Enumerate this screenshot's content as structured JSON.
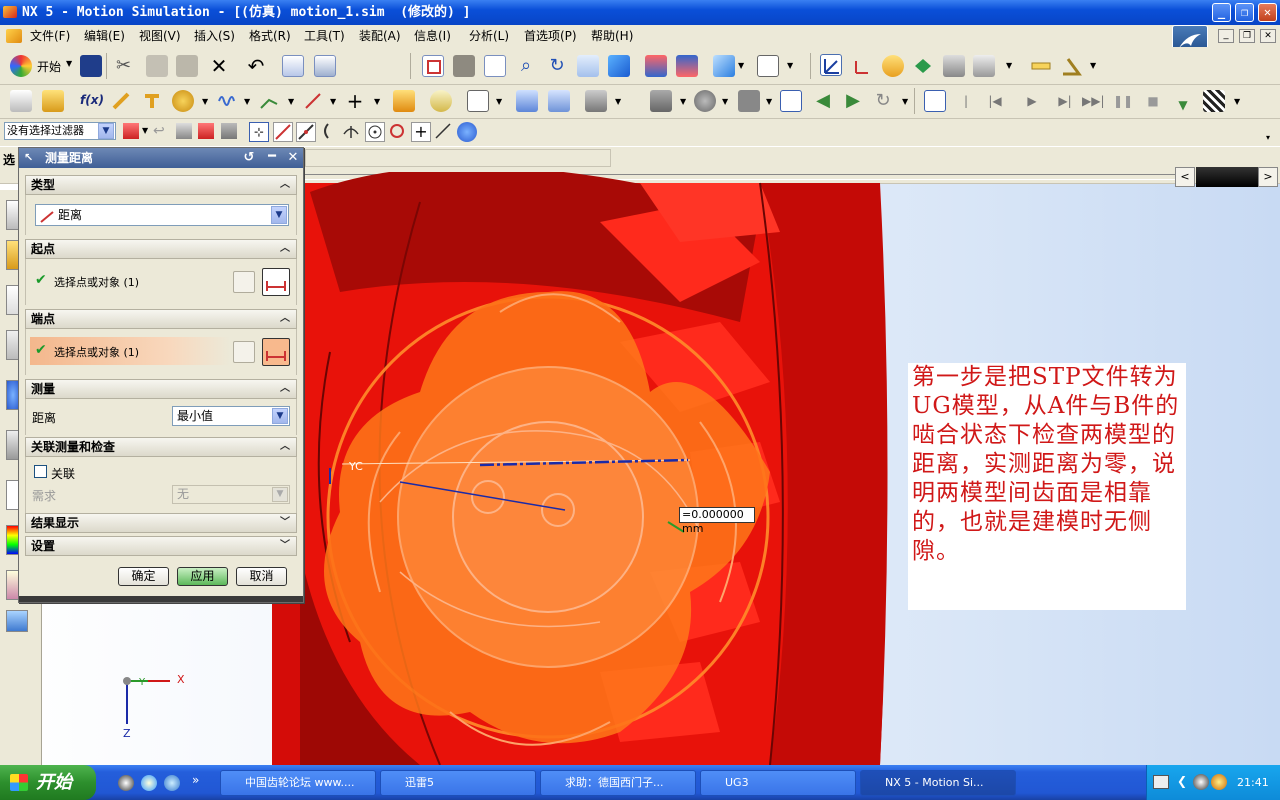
{
  "window": {
    "title": "NX 5 - Motion Simulation - [(仿真) motion_1.sim  (修改的) ]",
    "controls": [
      "minimize",
      "restore",
      "close"
    ]
  },
  "menubar": {
    "items": [
      "文件(F)",
      "编辑(E)",
      "视图(V)",
      "插入(S)",
      "格式(R)",
      "工具(T)",
      "装配(A)",
      "信息(I)",
      "分析(L)",
      "首选项(P)",
      "帮助(H)"
    ]
  },
  "toolbar": {
    "start_label": "开始",
    "filter_value": "没有选择过滤器",
    "fx_label": "f(x)"
  },
  "selection_bar": {
    "label": "选"
  },
  "dialog": {
    "title": "测量距离",
    "sections": {
      "type": {
        "header": "类型",
        "value": "距离"
      },
      "start": {
        "header": "起点",
        "select_label": "选择点或对象 (1)"
      },
      "end": {
        "header": "端点",
        "select_label": "选择点或对象 (1)"
      },
      "measure": {
        "header": "测量",
        "field_label": "距离",
        "value": "最小值"
      },
      "assoc": {
        "header": "关联测量和检查",
        "checkbox_label": "关联",
        "need_label": "需求",
        "need_value": "无"
      },
      "results": {
        "header": "结果显示"
      },
      "settings": {
        "header": "设置"
      }
    },
    "buttons": {
      "ok": "确定",
      "apply": "应用",
      "cancel": "取消"
    }
  },
  "viewport": {
    "measurement_label": "=0.000000 mm",
    "axis_x": "X",
    "axis_y": "Y",
    "axis_z": "Z",
    "axis_yc": "YC",
    "note_text": "第一步是把STP文件转为UG模型，从A件与B件的啮合状态下检查两模型的距离，实测距离为零，说明两模型间齿面是相靠的，也就是建模时无侧隙。",
    "colors": {
      "gear_red": "#e8120a",
      "gear_orange": "#ff7a1a",
      "note_red": "#d01818"
    }
  },
  "taskbar": {
    "start": "开始",
    "tasks": [
      {
        "label": "中国齿轮论坛 www....",
        "active": false
      },
      {
        "label": "迅雷5",
        "active": false
      },
      {
        "label": "求助：德国西门子...",
        "active": false
      },
      {
        "label": "UG3",
        "active": false
      },
      {
        "label": "NX 5 - Motion Si...",
        "active": true
      }
    ],
    "clock": "21:41"
  }
}
